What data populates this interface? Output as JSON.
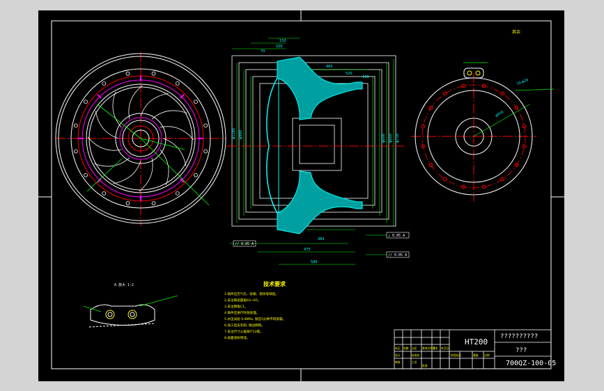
{
  "drawing": {
    "material": "HT200",
    "title_cn": "??????????",
    "part_name": "???",
    "drawing_number": "700QZ-100-05",
    "tech_heading": "技术要求",
    "tech_notes": [
      "1.铸件应无气孔、砂眼、裂纹等缺陷。",
      "2.未注铸造圆角R3~R5。",
      "3.未注倒角C1。",
      "4.铸件应进行时效处理。",
      "5.水压试验 0.6MPa, 保压5分钟不得渗漏。",
      "6.加工后去毛刺, 锐边倒钝。",
      "7.未注尺寸公差按IT12级。",
      "8.表面涂防锈漆。"
    ],
    "detail_label": "A 放大 1:2",
    "roughness_note": "其余",
    "dims_top": [
      "150",
      "100",
      "70"
    ],
    "dims_side": [
      "465",
      "520",
      "100"
    ],
    "dims_left": [
      "φ1180",
      "φ990"
    ],
    "dims_bottom": [
      "385",
      "475",
      "586"
    ],
    "dims_right": [
      "φ600",
      "φ660",
      "φ710"
    ],
    "tolerance_frames": [
      "// 0.05 A",
      "⊥ 0.05 A",
      "// 0.05 A"
    ],
    "dims_right_view": [
      "16-φ26",
      "φ650"
    ],
    "title_block_cells": [
      "标记",
      "处数",
      "分区",
      "更改文件号",
      "签名",
      "年月日",
      "设计",
      "标准化",
      "阶段标记",
      "重量",
      "比例",
      "审核",
      "工艺",
      "批准"
    ]
  }
}
